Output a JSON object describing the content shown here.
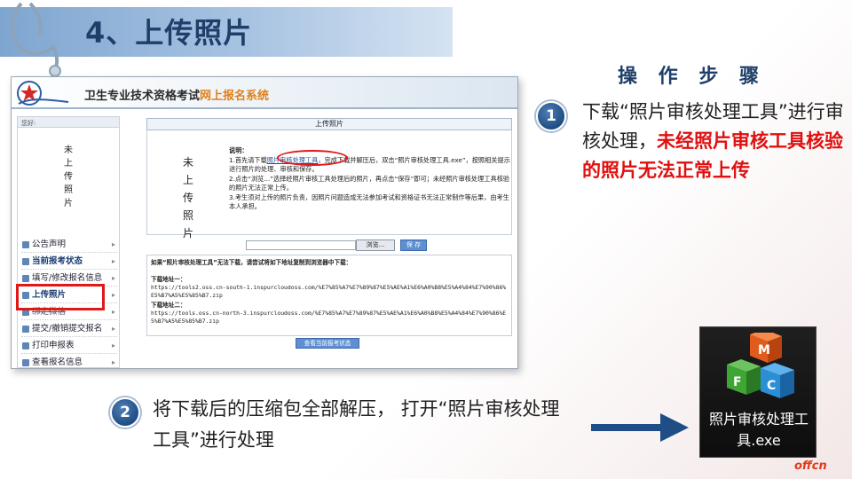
{
  "slide": {
    "title": "4、上传照片",
    "steps_heading": "操 作 步 骤",
    "step1": {
      "number": "1",
      "text_normal": "下载“照片审核处理工具”进行审核处理，",
      "text_red": "未经照片审核工具核验的照片无法正常上传"
    },
    "step2": {
      "number": "2",
      "text": "将下载后的压缩包全部解压， 打开“照片审核处理工具”进行处理"
    },
    "exe_icon": {
      "label": "照片审核处理工具.exe",
      "letters": [
        "M",
        "F",
        "C"
      ]
    },
    "brand": "offcn",
    "colors": {
      "title_blue": "#1f3f6a",
      "highlight_red": "#e01010",
      "badge_blue": "#1f4d85"
    }
  },
  "screenshot": {
    "site_title": "卫生专业技术资格考试",
    "site_title_highlight": "网上报名系统",
    "side_top_label": "您好:",
    "side_photo_text": "未上传照片",
    "menu": [
      {
        "label": "公告声明",
        "style": "normal"
      },
      {
        "label": "当前报考状态",
        "style": "bold"
      },
      {
        "label": "填写/修改报名信息",
        "style": "normal"
      },
      {
        "label": "上传照片",
        "style": "bold"
      },
      {
        "label": "绑定微信",
        "style": "strike"
      },
      {
        "label": "提交/撤销提交报名",
        "style": "normal"
      },
      {
        "label": "打印申报表",
        "style": "normal"
      },
      {
        "label": "查看报名信息",
        "style": "normal"
      }
    ],
    "tab_label": "上传照片",
    "photo_placeholder": "未上传照片",
    "desc_label": "说明：",
    "desc_lines": [
      "1.首先请下载照片审核处理工具，完成下载并解压后，双击“照片审核处理工具.exe”，按照相关提示进行照片的处理、审核和保存。",
      "2.点击“浏览...”选择经照片审核工具处理后的照片，再点击“保存”即可；未经照片审核处理工具核验的照片无法正常上传。",
      "3.考生须对上传的照片负责，因照片问题造成无法参加考试和资格证书无法正常制作等后果，由考生本人承担。"
    ],
    "desc_link": "照片审核处理工具",
    "browse_label": "浏览...",
    "save_label": "保 存",
    "download_note": "如果“照片审核处理工具”无法下载，请尝试将如下地址复制到浏览器中下载：",
    "download1_label": "下载地址一：",
    "download1_url": "https://tools2.oss.cn-south-1.inspurcloudoss.com/%E7%85%A7%E7%89%87%E5%AE%A1%E6%A0%B8%E5%A4%84%E7%90%86%E5%B7%A5%E5%85%B7.zip",
    "download2_label": "下载地址二：",
    "download2_url": "https://tools.oss.cn-north-3.inspurcloudoss.com/%E7%85%A7%E7%89%87%E5%AE%A1%E6%A0%B8%E5%A4%84%E7%90%86%E5%B7%A5%E5%85%B7.zip",
    "view_status_label": "查看当前报考状态"
  }
}
